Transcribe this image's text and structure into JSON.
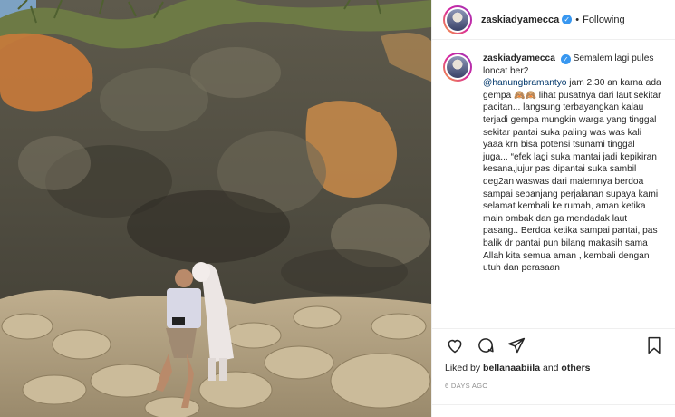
{
  "post": {
    "username": "zaskiadyamecca",
    "follow_label": "Following",
    "separator": "•",
    "caption": {
      "username": "zaskiadyamecca",
      "line1": "Semalem lagi pules loncat ber2",
      "mention": "@hanungbramantyo",
      "after_mention": " jam 2.30 an karna ada gempa",
      "emojis": "🙈🙈",
      "rest": " lihat pusatnya dari laut sekitar pacitan... langsung terbayangkan kalau terjadi gempa mungkin warga yang tinggal sekitar pantai suka paling was was kali yaaa krn bisa potensi tsunami tinggal juga... “efek lagi suka mantai jadi kepikiran kesana,jujur pas dipantai suka sambil deg2an waswas dari malemnya berdoa sampai sepanjang perjalanan supaya kami selamat kembali ke rumah, aman ketika main ombak dan ga mendadak laut pasang.. Berdoa ketika sampai pantai, pas balik dr pantai pun bilang makasih sama Allah kita semua aman , kembali dengan utuh dan perasaan"
    },
    "likes_prefix": "Liked by ",
    "liked_by": "bellanaabiila",
    "likes_and": " and ",
    "likes_others": "others",
    "time_ago": "6 DAYS AGO"
  },
  "icons": {
    "like": "heart-icon",
    "comment": "comment-icon",
    "share": "share-icon",
    "save": "bookmark-icon",
    "verified": "verified-badge-icon"
  },
  "colors": {
    "accent_blue": "#3897f0",
    "mention": "#00376b",
    "muted": "#8e8e8e"
  }
}
